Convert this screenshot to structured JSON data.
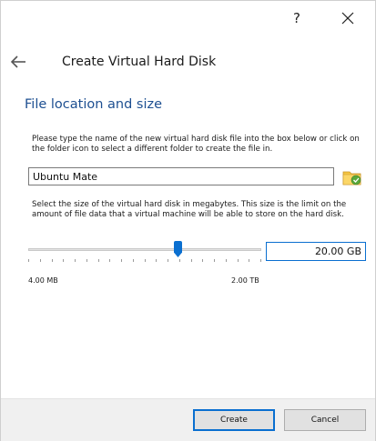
{
  "titlebar": {
    "help_label": "?",
    "help_icon": "question-mark-icon",
    "close_icon": "close-icon"
  },
  "wizard": {
    "back_icon": "back-arrow-icon",
    "title": "Create Virtual Hard Disk"
  },
  "section": {
    "title": "File location and size"
  },
  "file_location": {
    "description": "Please type the name of the new virtual hard disk file into the box below or click on the folder icon to select a different folder to create the file in.",
    "value": "Ubuntu Mate",
    "folder_icon": "folder-icon"
  },
  "file_size": {
    "description": "Select the size of the virtual hard disk in megabytes. This size is the limit on the amount of file data that a virtual machine will be able to store on the hard disk.",
    "min_label": "4.00 MB",
    "max_label": "2.00 TB",
    "value": "20.00 GB",
    "slider_fraction": 0.64
  },
  "buttons": {
    "create": "Create",
    "cancel": "Cancel"
  },
  "colors": {
    "accent": "#0a6fd0",
    "section_title": "#1d4f91",
    "footer_bg": "#f0f0f0",
    "folder_yellow": "#f5c542",
    "folder_green": "#5aa83a"
  }
}
